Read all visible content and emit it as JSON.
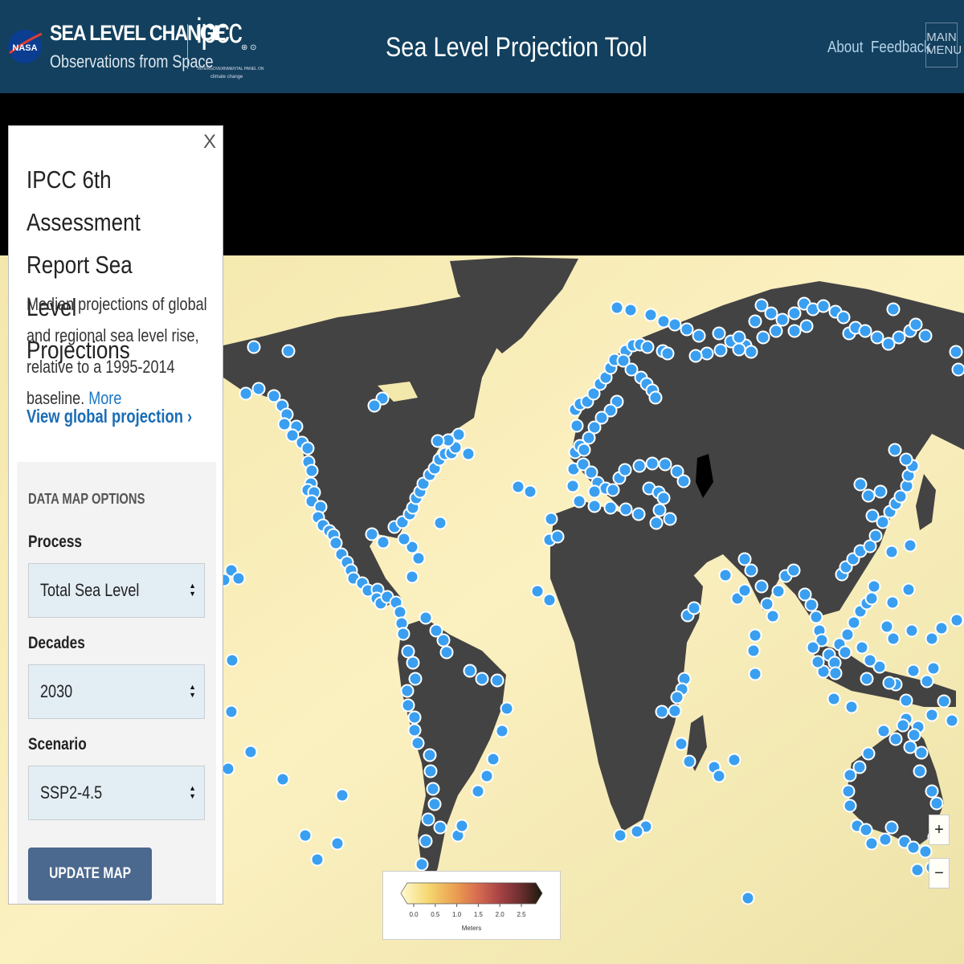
{
  "header": {
    "agency": "NASA",
    "brand_title": "SEA LEVEL CHANGE",
    "brand_subtitle": "Observations from Space",
    "partner_logo": "ipcc",
    "partner_tagline": "INTERGOVERNMENTAL PANEL ON",
    "partner_tagline2": "climate change",
    "partner_emblems": "WMO UNEP",
    "app_title": "Sea Level Projection Tool",
    "nav": [
      {
        "label": "About"
      },
      {
        "label": "Feedback"
      }
    ],
    "main_menu_line1": "MAIN",
    "main_menu_line2": "MENU"
  },
  "panel": {
    "close_label": "X",
    "title": "IPCC 6th Assessment Report Sea Level Projections",
    "description": "Median projections of global and regional sea level rise, relative to a 1995-2014 baseline.",
    "more_link": "More",
    "global_link": "View global projection ›",
    "options": {
      "heading": "DATA MAP OPTIONS",
      "process_label": "Process",
      "process_value": "Total Sea Level",
      "decades_label": "Decades",
      "decades_value": "2030",
      "scenario_label": "Scenario",
      "scenario_value": "SSP2-4.5",
      "update_button": "UPDATE MAP"
    }
  },
  "legend": {
    "ticks": [
      "0.0",
      "0.5",
      "1.0",
      "1.5",
      "2.0",
      "2.5"
    ],
    "unit_label": "Meters",
    "range": [
      0,
      2.5
    ],
    "colors": [
      "#fffbd0",
      "#f4d66e",
      "#e99a4f",
      "#d66a50",
      "#a64346",
      "#6a2e2e",
      "#1c1a0a"
    ]
  },
  "zoom_controls": {
    "zoom_in": "+",
    "zoom_out": "−"
  },
  "colors": {
    "header_bg": "#12405e",
    "ocean": "#f7eab0",
    "land": "#434343",
    "marker": "#3a9ff0",
    "marker_stroke": "#ffffff",
    "accent_link": "#1a6db5",
    "button": "#4b688e"
  },
  "map": {
    "marker_icon": "tide-gauge-station-marker",
    "stations": [
      [
        316,
        432
      ],
      [
        359,
        437
      ],
      [
        322,
        484
      ],
      [
        306,
        490
      ],
      [
        341,
        493
      ],
      [
        351,
        505
      ],
      [
        357,
        516
      ],
      [
        354,
        528
      ],
      [
        369,
        531
      ],
      [
        364,
        542
      ],
      [
        376,
        551
      ],
      [
        383,
        558
      ],
      [
        384,
        575
      ],
      [
        388,
        586
      ],
      [
        387,
        602
      ],
      [
        383,
        610
      ],
      [
        391,
        613
      ],
      [
        388,
        624
      ],
      [
        399,
        631
      ],
      [
        396,
        644
      ],
      [
        402,
        654
      ],
      [
        410,
        661
      ],
      [
        415,
        666
      ],
      [
        418,
        676
      ],
      [
        425,
        690
      ],
      [
        432,
        700
      ],
      [
        437,
        710
      ],
      [
        440,
        720
      ],
      [
        451,
        726
      ],
      [
        458,
        735
      ],
      [
        470,
        734
      ],
      [
        469,
        745
      ],
      [
        474,
        751
      ],
      [
        482,
        743
      ],
      [
        493,
        750
      ],
      [
        498,
        762
      ],
      [
        500,
        776
      ],
      [
        502,
        789
      ],
      [
        508,
        811
      ],
      [
        514,
        825
      ],
      [
        517,
        845
      ],
      [
        507,
        860
      ],
      [
        508,
        878
      ],
      [
        516,
        893
      ],
      [
        516,
        909
      ],
      [
        520,
        925
      ],
      [
        535,
        940
      ],
      [
        536,
        960
      ],
      [
        539,
        982
      ],
      [
        541,
        1001
      ],
      [
        533,
        1020
      ],
      [
        530,
        1047
      ],
      [
        525,
        1076
      ],
      [
        548,
        1030
      ],
      [
        570,
        1040
      ],
      [
        575,
        1028
      ],
      [
        595,
        985
      ],
      [
        606,
        966
      ],
      [
        614,
        945
      ],
      [
        625,
        910
      ],
      [
        631,
        882
      ],
      [
        619,
        847
      ],
      [
        600,
        845
      ],
      [
        585,
        835
      ],
      [
        556,
        812
      ],
      [
        552,
        797
      ],
      [
        543,
        785
      ],
      [
        530,
        769
      ],
      [
        513,
        718
      ],
      [
        521,
        695
      ],
      [
        513,
        681
      ],
      [
        503,
        671
      ],
      [
        477,
        675
      ],
      [
        463,
        665
      ],
      [
        491,
        656
      ],
      [
        501,
        650
      ],
      [
        510,
        640
      ],
      [
        514,
        632
      ],
      [
        518,
        620
      ],
      [
        523,
        612
      ],
      [
        527,
        602
      ],
      [
        535,
        591
      ],
      [
        541,
        583
      ],
      [
        547,
        572
      ],
      [
        554,
        565
      ],
      [
        562,
        564
      ],
      [
        567,
        557
      ],
      [
        583,
        565
      ],
      [
        571,
        541
      ],
      [
        558,
        548
      ],
      [
        545,
        549
      ],
      [
        476,
        496
      ],
      [
        466,
        505
      ],
      [
        548,
        651
      ],
      [
        288,
        710
      ],
      [
        297,
        720
      ],
      [
        279,
        722
      ],
      [
        289,
        822
      ],
      [
        288,
        886
      ],
      [
        312,
        936
      ],
      [
        284,
        957
      ],
      [
        352,
        970
      ],
      [
        426,
        990
      ],
      [
        380,
        1040
      ],
      [
        395,
        1070
      ],
      [
        420,
        1050
      ],
      [
        645,
        606
      ],
      [
        660,
        612
      ],
      [
        686,
        646
      ],
      [
        684,
        672
      ],
      [
        694,
        668
      ],
      [
        684,
        747
      ],
      [
        669,
        736
      ],
      [
        713,
        605
      ],
      [
        714,
        584
      ],
      [
        716,
        563
      ],
      [
        722,
        555
      ],
      [
        718,
        530
      ],
      [
        716,
        510
      ],
      [
        722,
        503
      ],
      [
        731,
        500
      ],
      [
        739,
        490
      ],
      [
        747,
        478
      ],
      [
        754,
        470
      ],
      [
        760,
        458
      ],
      [
        765,
        448
      ],
      [
        779,
        437
      ],
      [
        788,
        430
      ],
      [
        797,
        429
      ],
      [
        806,
        432
      ],
      [
        825,
        437
      ],
      [
        831,
        440
      ],
      [
        776,
        449
      ],
      [
        786,
        460
      ],
      [
        798,
        470
      ],
      [
        805,
        478
      ],
      [
        812,
        486
      ],
      [
        816,
        495
      ],
      [
        768,
        500
      ],
      [
        760,
        511
      ],
      [
        749,
        520
      ],
      [
        740,
        532
      ],
      [
        733,
        545
      ],
      [
        727,
        560
      ],
      [
        726,
        578
      ],
      [
        736,
        588
      ],
      [
        744,
        601
      ],
      [
        754,
        608
      ],
      [
        763,
        610
      ],
      [
        771,
        595
      ],
      [
        778,
        585
      ],
      [
        796,
        580
      ],
      [
        812,
        577
      ],
      [
        828,
        578
      ],
      [
        843,
        587
      ],
      [
        851,
        599
      ],
      [
        808,
        608
      ],
      [
        820,
        613
      ],
      [
        826,
        620
      ],
      [
        821,
        635
      ],
      [
        795,
        640
      ],
      [
        779,
        634
      ],
      [
        760,
        632
      ],
      [
        740,
        612
      ],
      [
        721,
        624
      ],
      [
        740,
        630
      ],
      [
        817,
        651
      ],
      [
        834,
        646
      ],
      [
        856,
        766
      ],
      [
        864,
        757
      ],
      [
        852,
        845
      ],
      [
        849,
        858
      ],
      [
        843,
        868
      ],
      [
        840,
        885
      ],
      [
        824,
        886
      ],
      [
        848,
        926
      ],
      [
        858,
        948
      ],
      [
        804,
        1029
      ],
      [
        793,
        1035
      ],
      [
        772,
        1040
      ],
      [
        914,
        946
      ],
      [
        889,
        955
      ],
      [
        895,
        966
      ],
      [
        940,
        839
      ],
      [
        938,
        810
      ],
      [
        940,
        791
      ],
      [
        918,
        745
      ],
      [
        927,
        735
      ],
      [
        903,
        716
      ],
      [
        927,
        696
      ],
      [
        935,
        710
      ],
      [
        948,
        730
      ],
      [
        955,
        752
      ],
      [
        962,
        767
      ],
      [
        969,
        736
      ],
      [
        978,
        717
      ],
      [
        988,
        710
      ],
      [
        1002,
        740
      ],
      [
        1010,
        753
      ],
      [
        1016,
        768
      ],
      [
        1020,
        785
      ],
      [
        1023,
        797
      ],
      [
        1032,
        815
      ],
      [
        1039,
        825
      ],
      [
        1045,
        802
      ],
      [
        1055,
        790
      ],
      [
        1063,
        775
      ],
      [
        1071,
        761
      ],
      [
        1079,
        751
      ],
      [
        1085,
        745
      ],
      [
        1088,
        730
      ],
      [
        1048,
        715
      ],
      [
        1053,
        706
      ],
      [
        1062,
        696
      ],
      [
        1071,
        686
      ],
      [
        1083,
        680
      ],
      [
        1090,
        667
      ],
      [
        1099,
        650
      ],
      [
        1108,
        637
      ],
      [
        1115,
        627
      ],
      [
        1121,
        618
      ],
      [
        1129,
        605
      ],
      [
        1131,
        592
      ],
      [
        1136,
        580
      ],
      [
        1128,
        572
      ],
      [
        1114,
        560
      ],
      [
        1096,
        612
      ],
      [
        1081,
        617
      ],
      [
        1071,
        603
      ],
      [
        1086,
        642
      ],
      [
        1110,
        687
      ],
      [
        1133,
        679
      ],
      [
        1131,
        734
      ],
      [
        1111,
        750
      ],
      [
        1104,
        780
      ],
      [
        1112,
        795
      ],
      [
        1135,
        785
      ],
      [
        1160,
        795
      ],
      [
        1172,
        782
      ],
      [
        1191,
        772
      ],
      [
        1162,
        832
      ],
      [
        1154,
        848
      ],
      [
        1137,
        835
      ],
      [
        1128,
        872
      ],
      [
        1115,
        852
      ],
      [
        1107,
        850
      ],
      [
        1095,
        830
      ],
      [
        1083,
        822
      ],
      [
        1073,
        806
      ],
      [
        1052,
        812
      ],
      [
        1040,
        838
      ],
      [
        1038,
        870
      ],
      [
        1025,
        836
      ],
      [
        1018,
        824
      ],
      [
        1012,
        806
      ],
      [
        1060,
        880
      ],
      [
        1079,
        845
      ],
      [
        1175,
        873
      ],
      [
        1185,
        897
      ],
      [
        1160,
        890
      ],
      [
        1143,
        905
      ],
      [
        1133,
        930
      ],
      [
        1128,
        895
      ],
      [
        1115,
        920
      ],
      [
        1100,
        910
      ],
      [
        1081,
        938
      ],
      [
        1070,
        955
      ],
      [
        1058,
        965
      ],
      [
        1056,
        985
      ],
      [
        1058,
        1003
      ],
      [
        1067,
        1028
      ],
      [
        1078,
        1033
      ],
      [
        1085,
        1050
      ],
      [
        1102,
        1045
      ],
      [
        1110,
        1030
      ],
      [
        1126,
        1048
      ],
      [
        1137,
        1055
      ],
      [
        1152,
        1060
      ],
      [
        1142,
        1083
      ],
      [
        1160,
        1080
      ],
      [
        1166,
        1000
      ],
      [
        1160,
        985
      ],
      [
        1145,
        960
      ],
      [
        1147,
        937
      ],
      [
        1138,
        915
      ],
      [
        1124,
        903
      ],
      [
        931,
        1118
      ],
      [
        1163,
        1042
      ],
      [
        1174,
        1025
      ],
      [
        768,
        383
      ],
      [
        785,
        386
      ],
      [
        810,
        392
      ],
      [
        826,
        400
      ],
      [
        840,
        404
      ],
      [
        855,
        410
      ],
      [
        870,
        418
      ],
      [
        895,
        415
      ],
      [
        910,
        425
      ],
      [
        928,
        430
      ],
      [
        948,
        380
      ],
      [
        960,
        390
      ],
      [
        974,
        398
      ],
      [
        989,
        390
      ],
      [
        1001,
        378
      ],
      [
        1012,
        385
      ],
      [
        1025,
        381
      ],
      [
        1040,
        388
      ],
      [
        1050,
        395
      ],
      [
        1057,
        415
      ],
      [
        1065,
        408
      ],
      [
        1077,
        412
      ],
      [
        1092,
        420
      ],
      [
        1106,
        428
      ],
      [
        1119,
        420
      ],
      [
        1133,
        412
      ],
      [
        1190,
        438
      ],
      [
        1193,
        460
      ],
      [
        1152,
        418
      ],
      [
        1140,
        404
      ],
      [
        1112,
        385
      ],
      [
        1004,
        406
      ],
      [
        989,
        412
      ],
      [
        966,
        412
      ],
      [
        950,
        420
      ],
      [
        935,
        438
      ],
      [
        920,
        435
      ],
      [
        897,
        436
      ],
      [
        880,
        440
      ],
      [
        866,
        443
      ],
      [
        920,
        420
      ],
      [
        940,
        400
      ]
    ]
  }
}
